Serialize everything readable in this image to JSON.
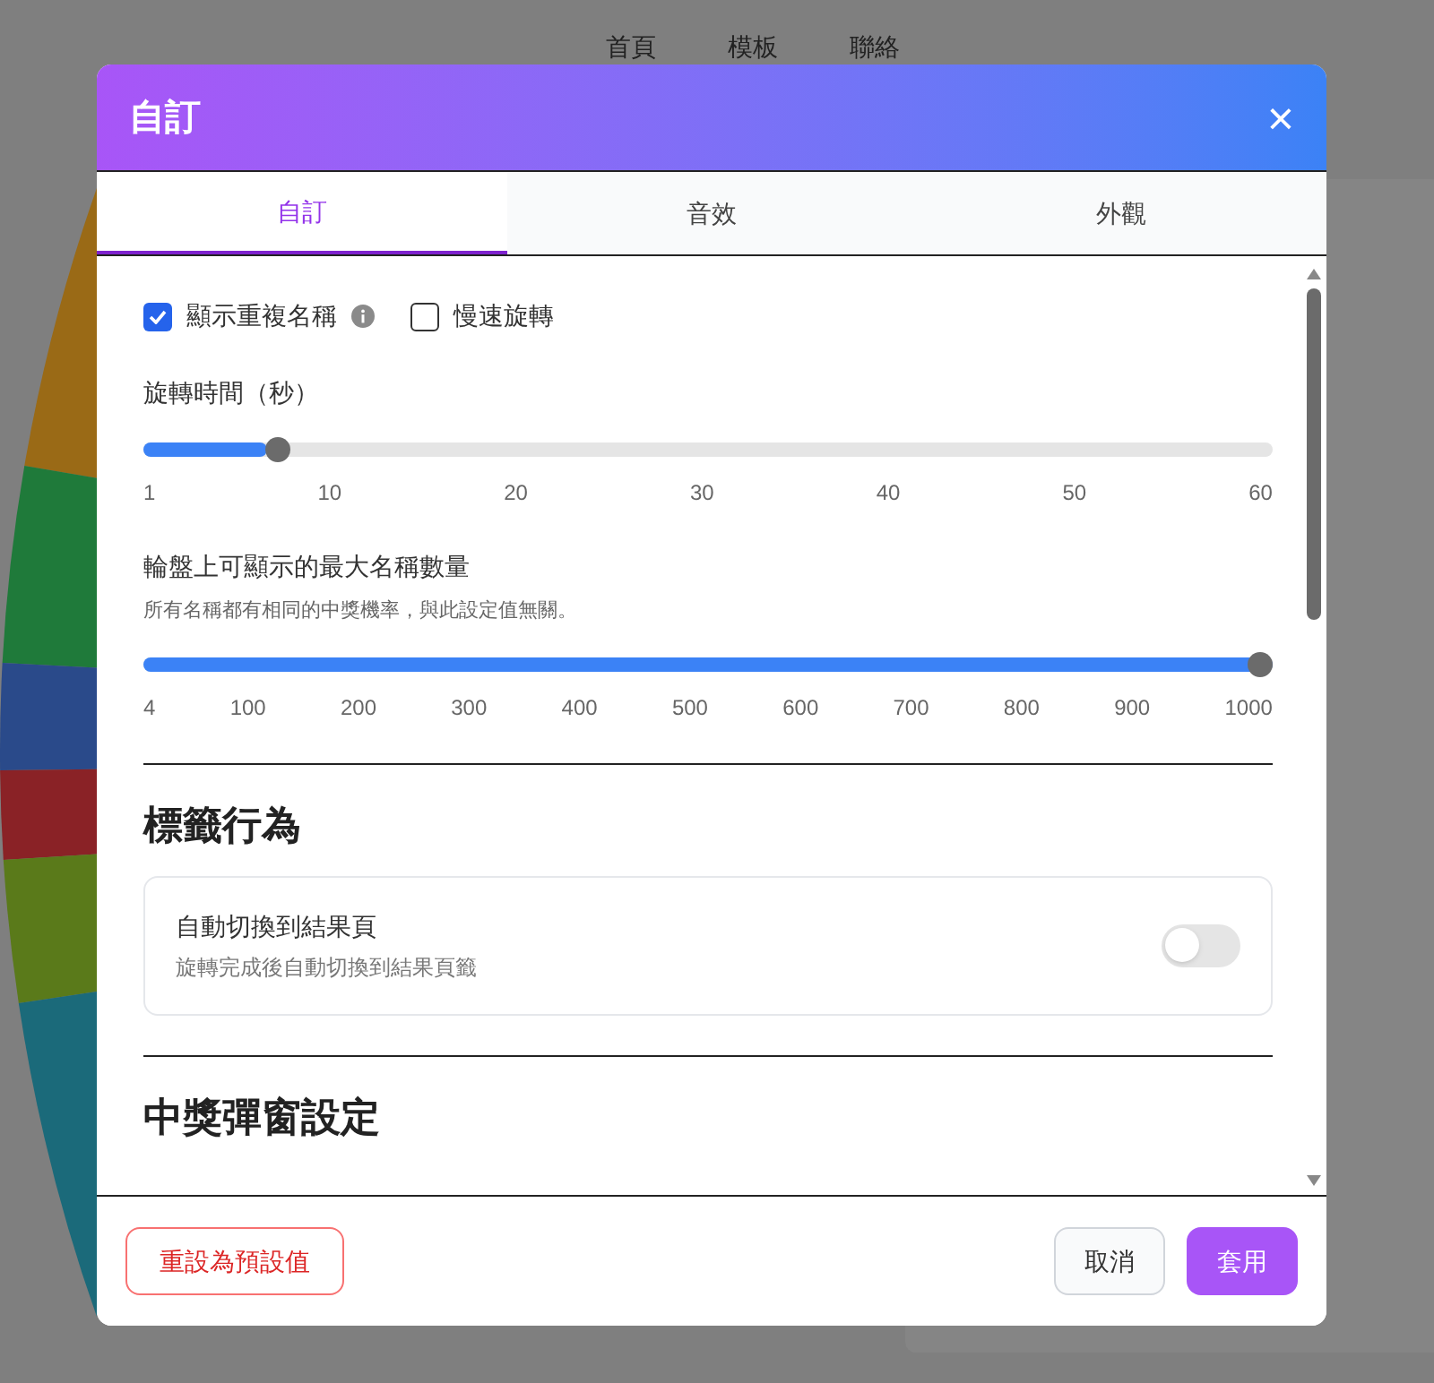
{
  "nav": [
    "首頁",
    "模板",
    "聯絡"
  ],
  "dialog": {
    "title": "自訂",
    "close": "×",
    "tabs": [
      {
        "label": "自訂",
        "selected": true
      },
      {
        "label": "音效",
        "selected": false
      },
      {
        "label": "外觀",
        "selected": false
      }
    ],
    "checkboxes": [
      {
        "label": "顯示重複名稱",
        "checked": true,
        "info": true
      },
      {
        "label": "慢速旋轉",
        "checked": false,
        "info": false
      }
    ],
    "sliders": [
      {
        "label": "旋轉時間（秒）",
        "level": 0.11,
        "ticks": [
          "1",
          "10",
          "20",
          "30",
          "40",
          "50",
          "60"
        ]
      },
      {
        "label": "輪盤上可顯示的最大名稱數量",
        "hint": "所有名稱都有相同的中獎機率，與此設定值無關。",
        "level": 1,
        "ticks": [
          "4",
          "100",
          "200",
          "300",
          "400",
          "500",
          "600",
          "700",
          "800",
          "900",
          "1000"
        ]
      }
    ],
    "sections": [
      {
        "heading": "標籤行為",
        "toggles": [
          {
            "title": "自動切換到結果頁",
            "description": "旋轉完成後自動切換到結果頁籤",
            "on": false
          }
        ]
      },
      {
        "heading": "中獎彈窗設定"
      }
    ],
    "reset": "重設為預設值",
    "cancel": "取消",
    "apply": "套用"
  }
}
